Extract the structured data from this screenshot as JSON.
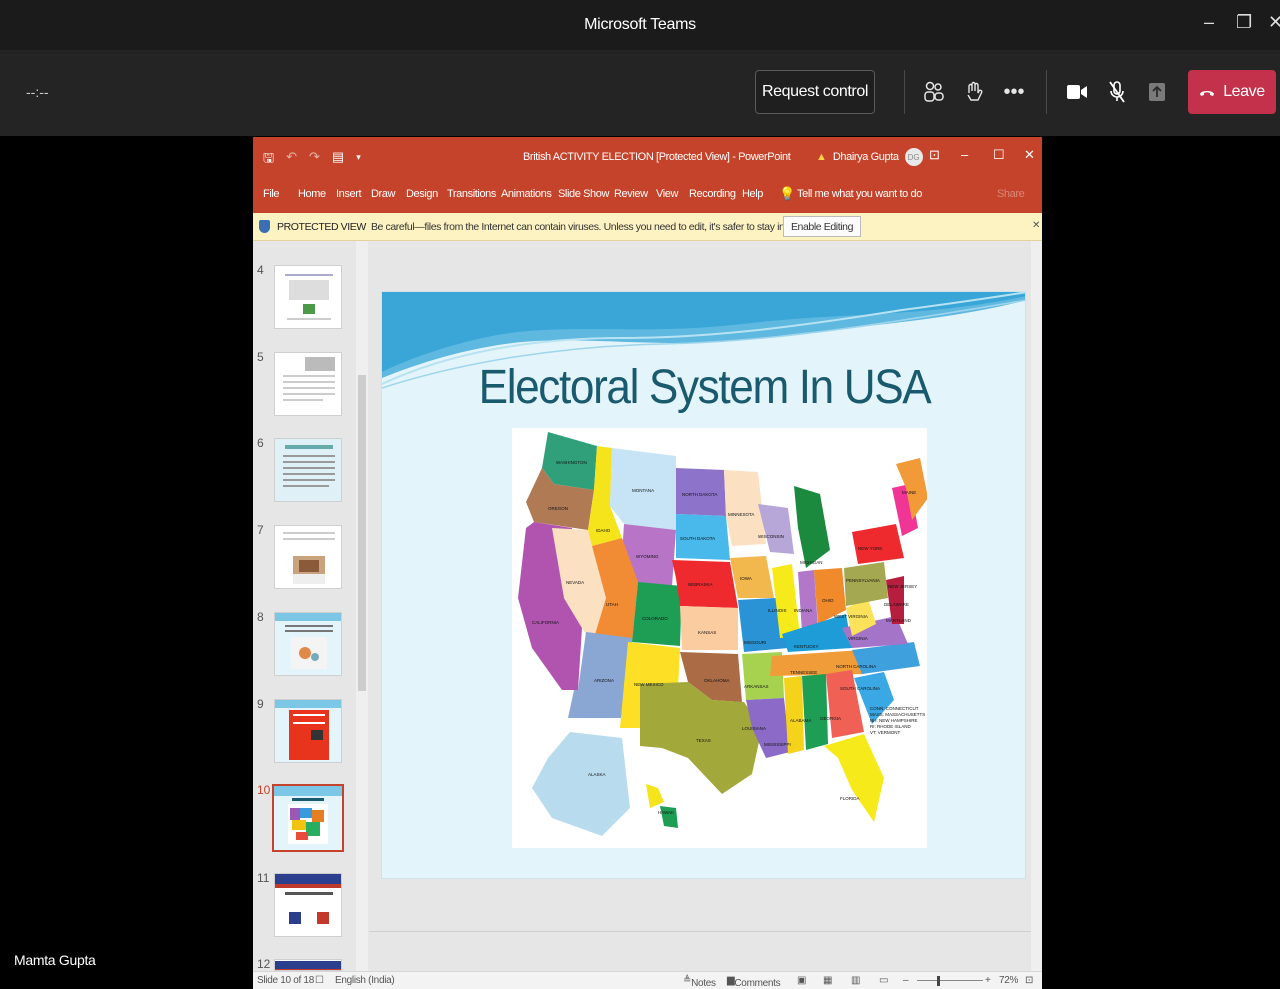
{
  "teams": {
    "window_title": "Microsoft Teams",
    "timer": "--:--",
    "request_control_label": "Request control",
    "leave_label": "Leave",
    "participant_name": "Mamta Gupta"
  },
  "ppt": {
    "doc_title": "British ACTIVITY ELECTION [Protected View]  -  PowerPoint",
    "user_name": "Dhairya Gupta",
    "user_initials": "DG",
    "ribbon_tabs": [
      "File",
      "Home",
      "Insert",
      "Draw",
      "Design",
      "Transitions",
      "Animations",
      "Slide Show",
      "Review",
      "View",
      "Recording",
      "Help"
    ],
    "tell_me": "Tell me what you want to do",
    "share": "Share",
    "protected_label": "PROTECTED VIEW",
    "protected_message": "Be careful—files from the Internet can contain viruses. Unless you need to edit, it's safer to stay in Protected View.",
    "enable_editing": "Enable Editing",
    "thumb_numbers": [
      "4",
      "5",
      "6",
      "7",
      "8",
      "9",
      "10",
      "11",
      "12"
    ],
    "slide_title": "Electoral System In USA",
    "status_slide": "Slide 10 of 18",
    "status_language": "English (India)",
    "status_notes": "Notes",
    "status_comments": "Comments",
    "zoom": "72%"
  },
  "map_labels": {
    "washington": "WASHINGTON",
    "oregon": "OREGON",
    "california": "CALIFORNIA",
    "nevada": "NEVADA",
    "idaho": "IDAHO",
    "montana": "MONTANA",
    "wyoming": "WYOMING",
    "utah": "UTAH",
    "arizona": "ARIZONA",
    "colorado": "COLORADO",
    "new_mexico": "NEW MEXICO",
    "north_dakota": "NORTH DAKOTA",
    "south_dakota": "SOUTH DAKOTA",
    "nebraska": "NEBRASKA",
    "kansas": "KANSAS",
    "oklahoma": "OKLAHOMA",
    "texas": "TEXAS",
    "minnesota": "MINNESOTA",
    "iowa": "IOWA",
    "missouri": "MISSOURI",
    "arkansas": "ARKANSAS",
    "louisiana": "LOUISIANA",
    "wisconsin": "WISCONSIN",
    "illinois": "ILLINOIS",
    "michigan": "MICHIGAN",
    "indiana": "INDIANA",
    "ohio": "OHIO",
    "kentucky": "KENTUCKY",
    "tennessee": "TENNESSEE",
    "mississippi": "MISSISSIPPI",
    "alabama": "ALABAMA",
    "georgia": "GEORGIA",
    "florida": "FLORIDA",
    "south_carolina": "SOUTH CAROLINA",
    "north_carolina": "NORTH CAROLINA",
    "virginia": "VIRGINIA",
    "west_virginia": "WEST VIRGINIA",
    "pennsylvania": "PENNSYLVANIA",
    "new_york": "NEW YORK",
    "maine": "MAINE",
    "new_jersey": "NEW JERSEY",
    "delaware": "DELAWARE",
    "maryland": "MARYLAND",
    "alaska": "ALASKA",
    "hawaii": "HAWAII",
    "legend_1": "CONN: CONNECTICUT",
    "legend_2": "MASS: MASSACHUSETTS",
    "legend_3": "NH: NEW HAMPSHIRE",
    "legend_4": "RI: RHODE ISLAND",
    "legend_5": "VT: VERMONT"
  },
  "colors": {
    "teams_leave": "#c4314b",
    "ppt_accent": "#c5432a"
  }
}
